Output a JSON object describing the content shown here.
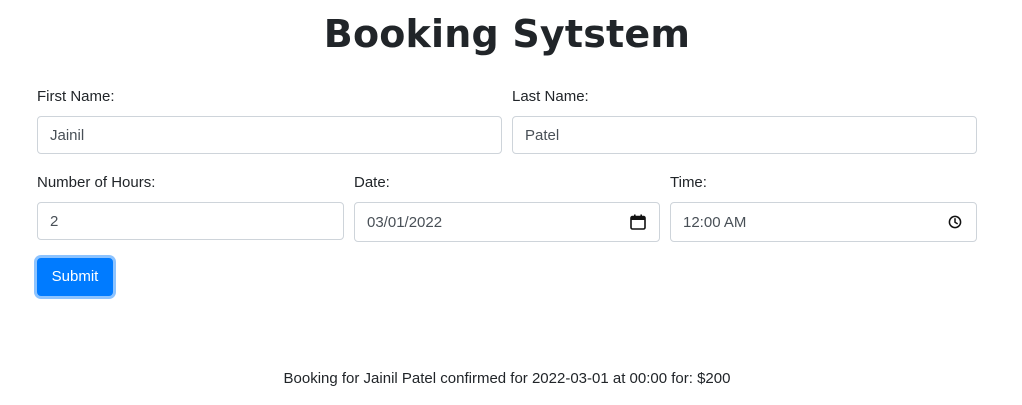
{
  "title": "Booking Sytstem",
  "form": {
    "first_name": {
      "label": "First Name:",
      "value": "Jainil"
    },
    "last_name": {
      "label": "Last Name:",
      "value": "Patel"
    },
    "hours": {
      "label": "Number of Hours:",
      "value": "2"
    },
    "date": {
      "label": "Date:",
      "value": "03/01/2022",
      "icon": "calendar-icon"
    },
    "time": {
      "label": "Time:",
      "value": "12:00 AM",
      "icon": "clock-icon"
    },
    "submit_label": "Submit"
  },
  "confirmation": "Booking for Jainil Patel confirmed for 2022-03-01 at 00:00 for: $200",
  "colors": {
    "primary": "#007bff",
    "text": "#212529",
    "input_border": "#ced4da"
  }
}
